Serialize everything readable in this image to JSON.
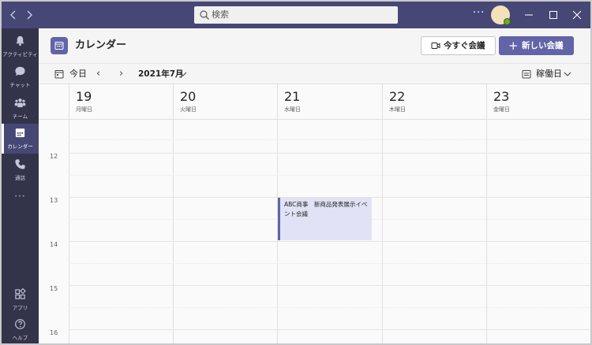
{
  "search": {
    "placeholder": "検索"
  },
  "rail": {
    "items": [
      {
        "label": "アクティビティ"
      },
      {
        "label": "チャット"
      },
      {
        "label": "チーム"
      },
      {
        "label": "カレンダー"
      },
      {
        "label": "通話"
      },
      {
        "label": "アプリ"
      },
      {
        "label": "ヘルプ"
      }
    ],
    "more": "···"
  },
  "titlebar": {
    "more": "···"
  },
  "header": {
    "title": "カレンダー",
    "meet_now_label": "今すぐ会議",
    "new_meeting_label": "新しい会議",
    "new_meeting_plus": "+"
  },
  "toolbar": {
    "today_label": "今日",
    "prev": "‹",
    "next": "›",
    "month_label": "2021年7月",
    "view_label": "稼働日"
  },
  "days": [
    {
      "num": "19",
      "name": "月曜日"
    },
    {
      "num": "20",
      "name": "火曜日"
    },
    {
      "num": "21",
      "name": "水曜日"
    },
    {
      "num": "22",
      "name": "木曜日"
    },
    {
      "num": "23",
      "name": "金曜日"
    }
  ],
  "hours": [
    "12",
    "13",
    "14",
    "15",
    "16"
  ],
  "event": {
    "title": "ABC商事　新商品発表展示イベント会議"
  },
  "colors": {
    "brand": "#6264a7",
    "titlebar": "#464775",
    "rail": "#33344a",
    "event_bg": "#e2e2f6"
  }
}
